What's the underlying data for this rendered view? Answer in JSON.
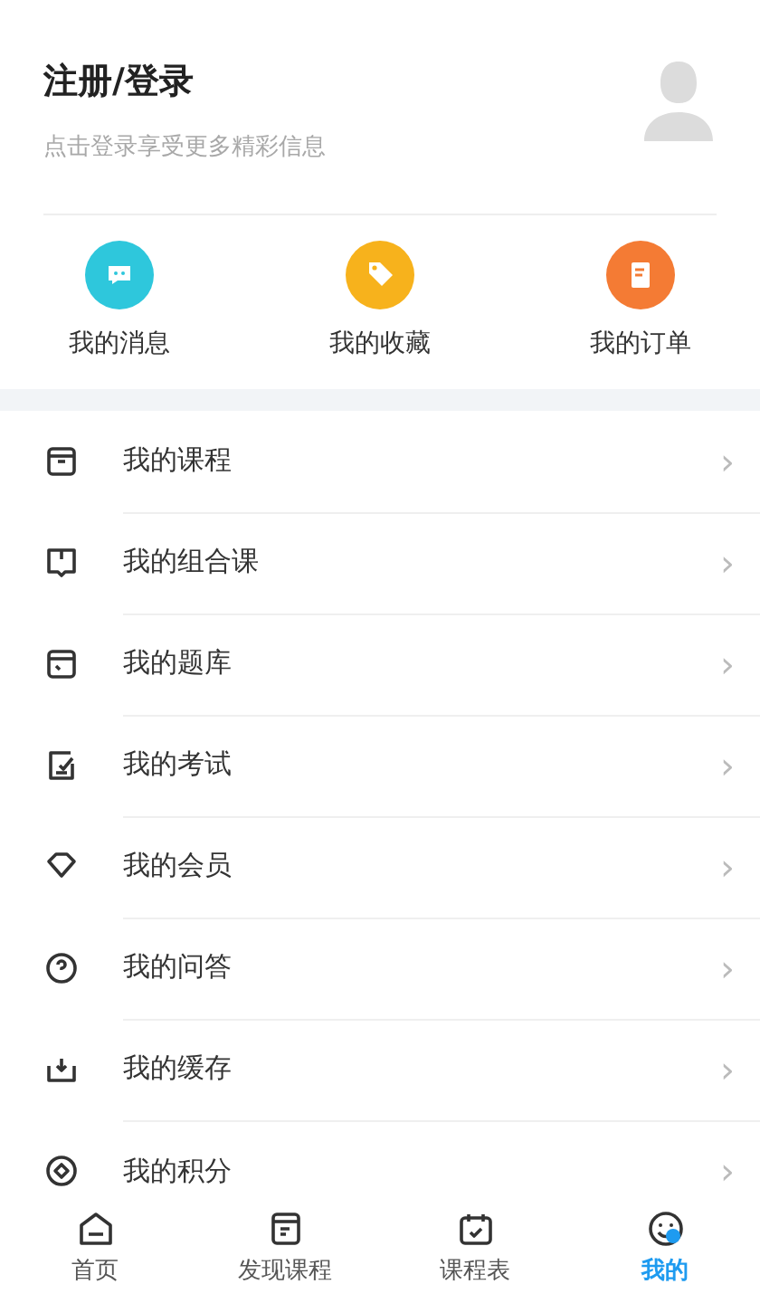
{
  "profile": {
    "title": "注册/登录",
    "subtitle": "点击登录享受更多精彩信息"
  },
  "quick_actions": [
    {
      "label": "我的消息",
      "color": "#2ec7dc"
    },
    {
      "label": "我的收藏",
      "color": "#f7b21c"
    },
    {
      "label": "我的订单",
      "color": "#f47b34"
    }
  ],
  "menu": [
    {
      "label": "我的课程",
      "chevron": "›"
    },
    {
      "label": "我的组合课",
      "chevron": "›"
    },
    {
      "label": "我的题库",
      "chevron": "›"
    },
    {
      "label": "我的考试",
      "chevron": "›"
    },
    {
      "label": "我的会员",
      "chevron": "›"
    },
    {
      "label": "我的问答",
      "chevron": "›"
    },
    {
      "label": "我的缓存",
      "chevron": "›"
    },
    {
      "label": "我的积分",
      "chevron": "›"
    }
  ],
  "tabs": [
    {
      "label": "首页",
      "selected": false
    },
    {
      "label": "发现课程",
      "selected": false
    },
    {
      "label": "课程表",
      "selected": false
    },
    {
      "label": "我的",
      "selected": true
    }
  ]
}
